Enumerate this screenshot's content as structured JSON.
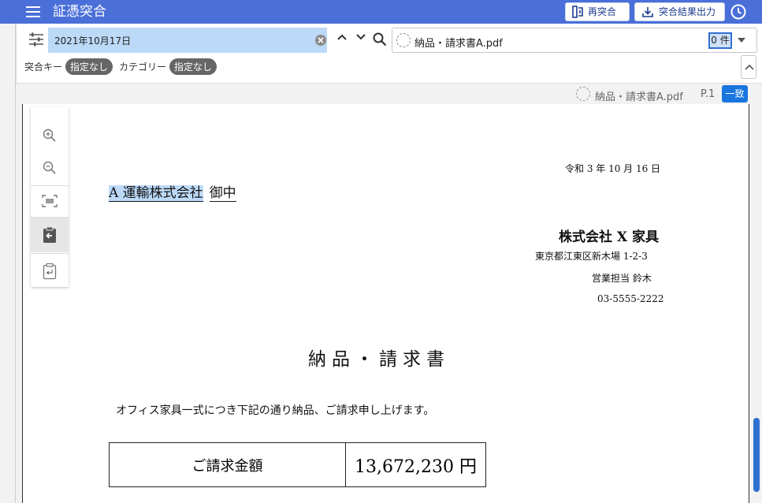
{
  "header": {
    "title": "証憑突合",
    "recheck_label": "再突合",
    "export_label": "突合結果出力"
  },
  "search": {
    "query": "2021年10月17日",
    "file_name": "納品・請求書A.pdf",
    "count": "0 件",
    "key_label": "突合キー",
    "key_value": "指定なし",
    "category_label": "カテゴリー",
    "category_value": "指定なし"
  },
  "status": {
    "file_name": "納品・請求書A.pdf",
    "page": "P.1",
    "match": "一致"
  },
  "document": {
    "date": "令和 3 年 10 月 16 日",
    "addressee": "A 運輸株式会社",
    "addressee_suffix": "御中",
    "company": "株式会社 X 家具",
    "address": "東京都江東区新木場 1-2-3",
    "person": "営業担当 鈴木",
    "phone": "03-5555-2222",
    "title": "納品・請求書",
    "intro": "オフィス家具一式につき下記の通り納品、ご請求申し上げます。",
    "amount_label": "ご請求金額",
    "amount_value": "13,672,230 円"
  },
  "colors": {
    "header_bg": "#4a6fd8",
    "highlight": "#bcd9f7",
    "match_badge": "#1976e0"
  }
}
